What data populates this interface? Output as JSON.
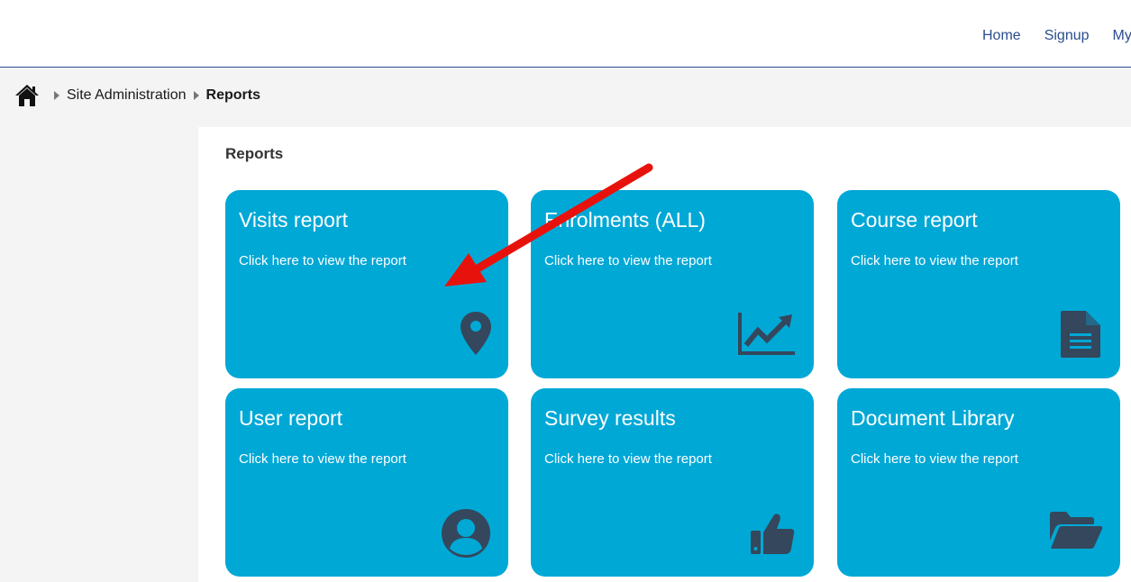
{
  "topnav": {
    "items": [
      "Home",
      "Signup",
      "My"
    ]
  },
  "breadcrumb": {
    "items": [
      "Site Administration",
      "Reports"
    ]
  },
  "page": {
    "section_title": "Reports"
  },
  "cards": [
    {
      "title": "Visits report",
      "subtitle": "Click here to view the report",
      "icon": "map-pin-icon"
    },
    {
      "title": "Enrolments (ALL)",
      "subtitle": "Click here to view the report",
      "icon": "line-chart-icon"
    },
    {
      "title": "Course report",
      "subtitle": "Click here to view the report",
      "icon": "document-icon"
    },
    {
      "title": "User report",
      "subtitle": "Click here to view the report",
      "icon": "user-circle-icon"
    },
    {
      "title": "Survey results",
      "subtitle": "Click here to view the report",
      "icon": "thumbs-up-icon"
    },
    {
      "title": "Document Library",
      "subtitle": "Click here to view the report",
      "icon": "folder-open-icon"
    }
  ],
  "colors": {
    "card": "#00a8d6",
    "icon": "#34475c",
    "nav": "#2a4d8f",
    "annotation_arrow": "#e8120c"
  }
}
